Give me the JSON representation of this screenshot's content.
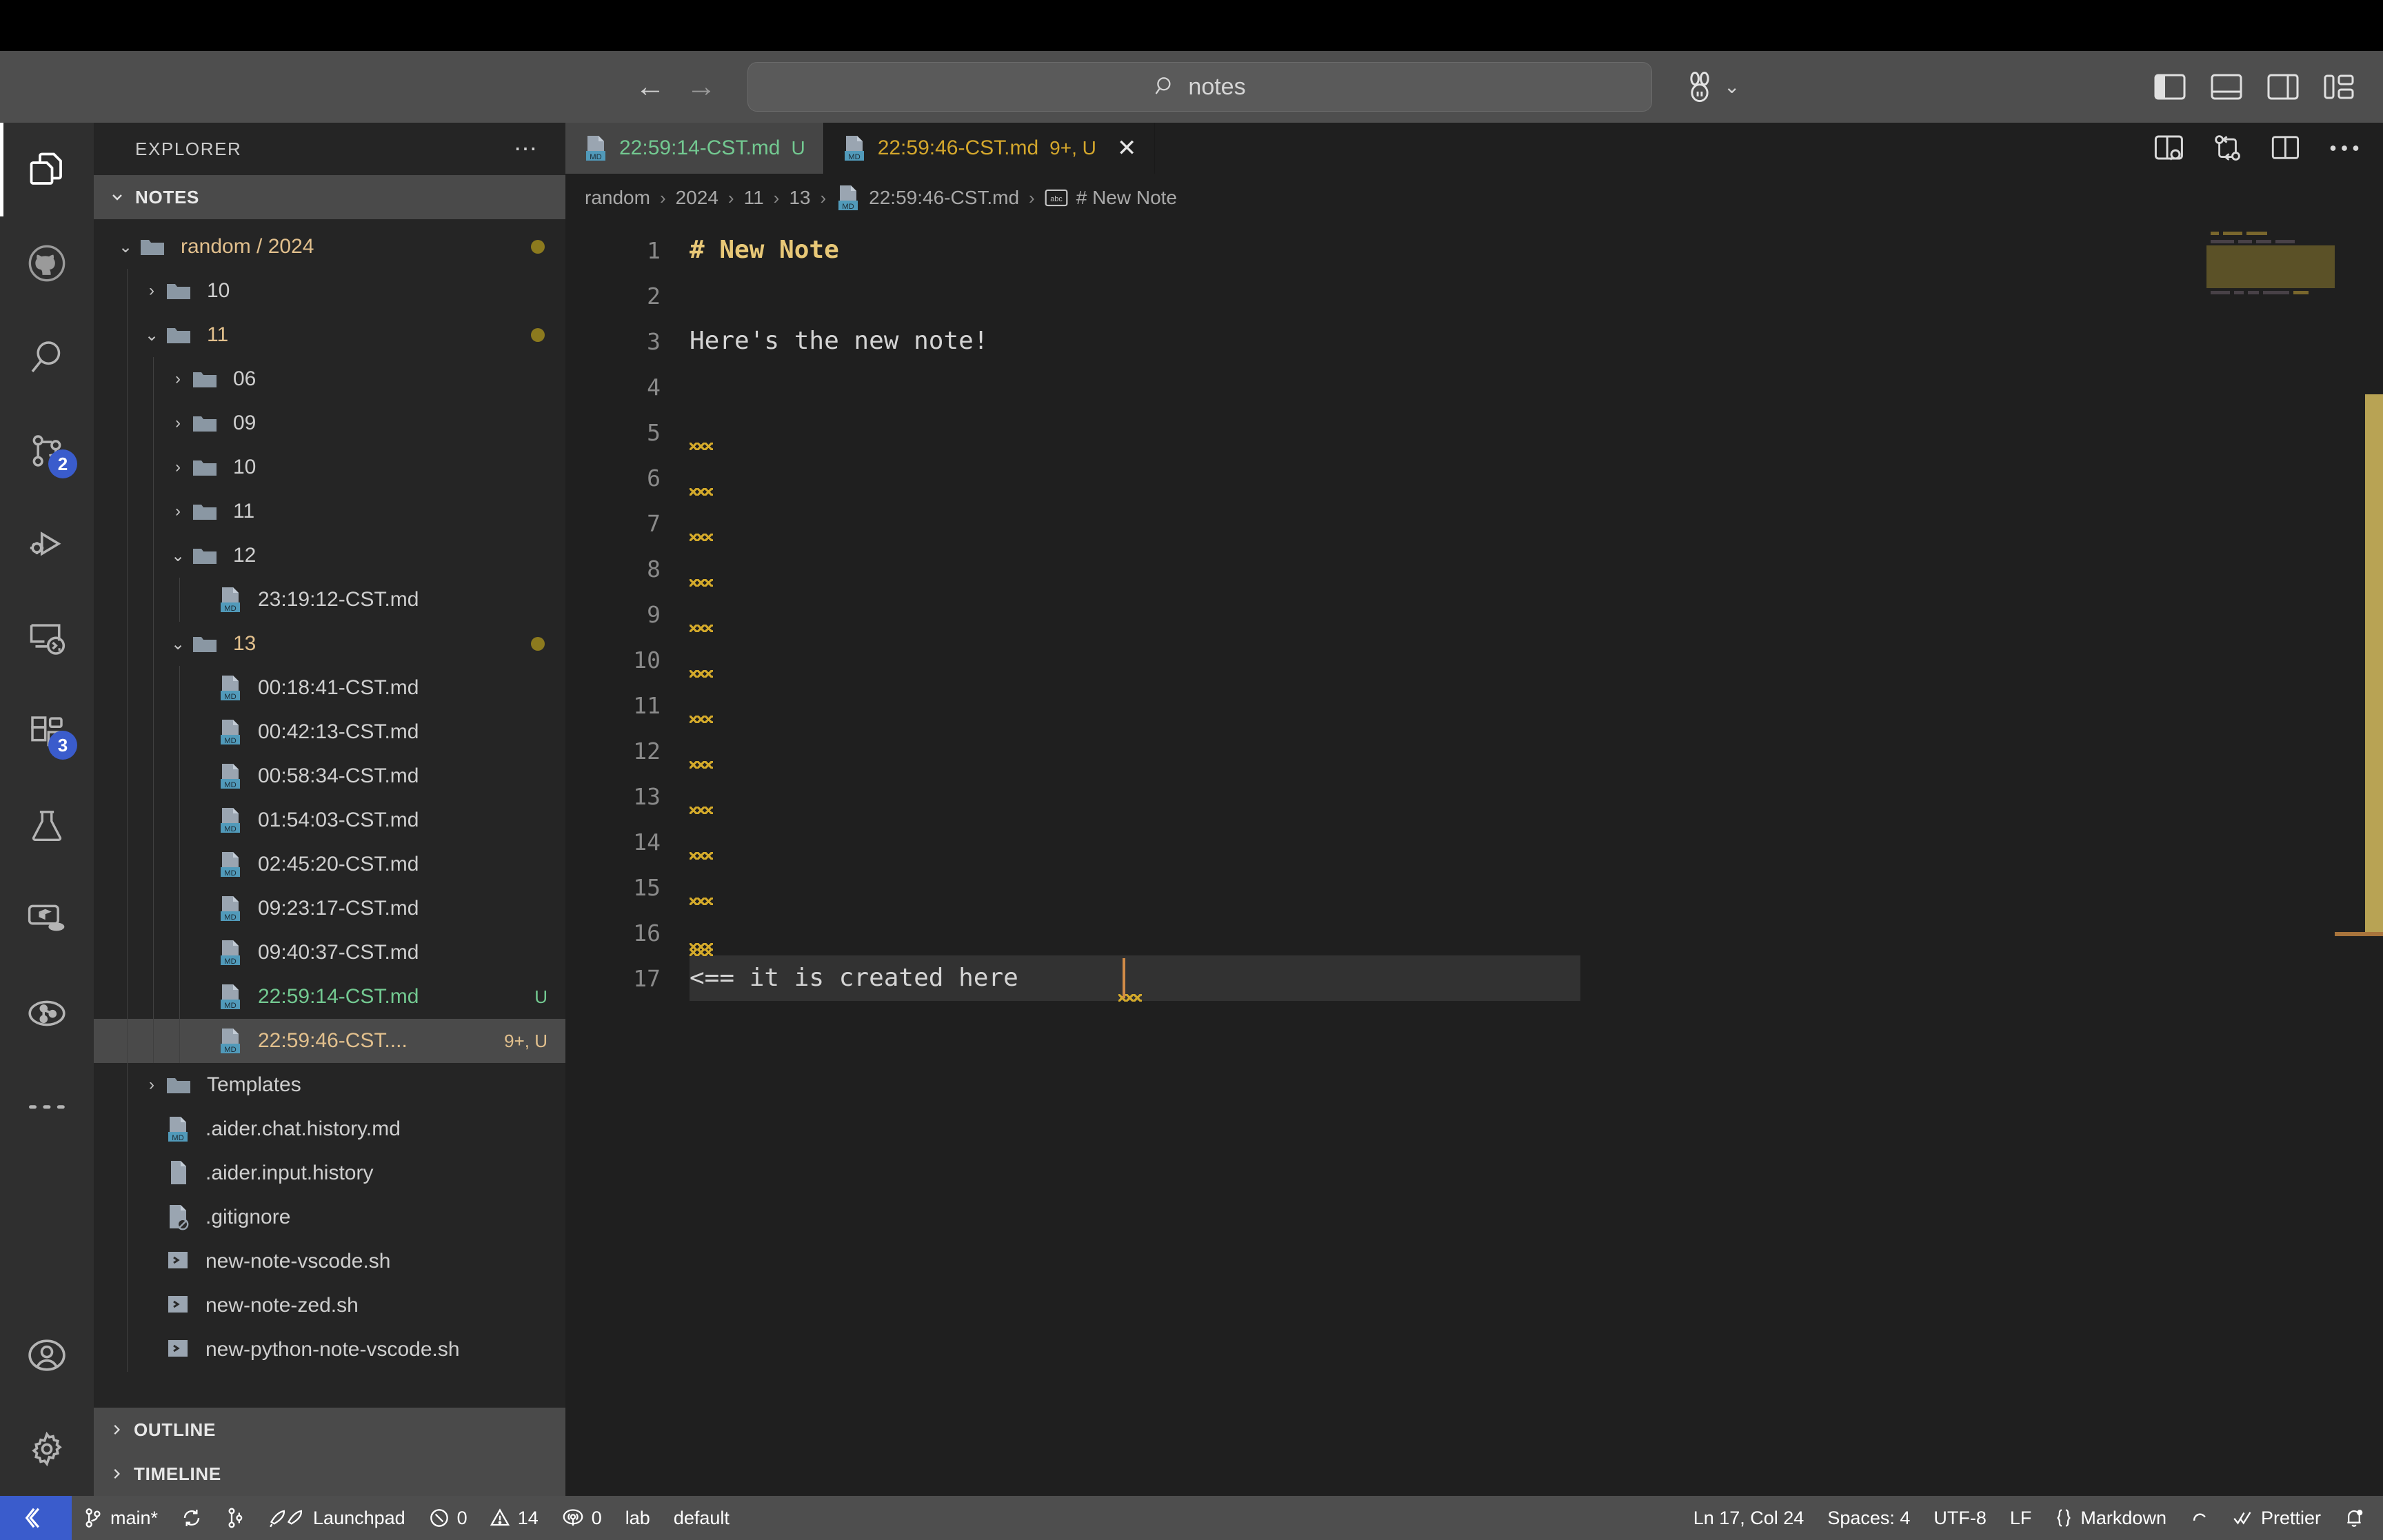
{
  "titlebar": {
    "back_label": "←",
    "forward_label": "→",
    "command_center_text": "notes",
    "rabbit_chevron": "⌄"
  },
  "activity_bar": {
    "items": [
      {
        "name": "explorer",
        "icon": "files-icon",
        "badge": ""
      },
      {
        "name": "github",
        "icon": "github-icon",
        "badge": ""
      },
      {
        "name": "search",
        "icon": "search-icon",
        "badge": ""
      },
      {
        "name": "source-control",
        "icon": "source-control-icon",
        "badge": "2"
      },
      {
        "name": "run-and-debug",
        "icon": "run-debug-icon",
        "badge": ""
      },
      {
        "name": "remote-explorer",
        "icon": "remote-explorer-icon",
        "badge": ""
      },
      {
        "name": "extensions",
        "icon": "extensions-icon",
        "badge": "3"
      },
      {
        "name": "testing",
        "icon": "beaker-icon",
        "badge": ""
      },
      {
        "name": "docker",
        "icon": "docker-icon",
        "badge": ""
      },
      {
        "name": "pipelines",
        "icon": "pipeline-icon",
        "badge": ""
      },
      {
        "name": "more-views",
        "icon": "ellipsis-icon",
        "badge": ""
      },
      {
        "name": "accounts",
        "icon": "account-icon",
        "badge": ""
      },
      {
        "name": "manage",
        "icon": "gear-icon",
        "badge": ""
      }
    ]
  },
  "sidebar": {
    "title": "EXPLORER",
    "more_actions": "⋯",
    "section": "NOTES",
    "tree": [
      {
        "depth": 0,
        "twisty": "⌄",
        "icon": "folder-icon",
        "label": "random / 2024",
        "label_style": "modified",
        "dot": true,
        "badge": ""
      },
      {
        "depth": 1,
        "twisty": "›",
        "icon": "folder-icon",
        "label": "10",
        "label_style": "",
        "dot": false,
        "badge": ""
      },
      {
        "depth": 1,
        "twisty": "⌄",
        "icon": "folder-icon",
        "label": "11",
        "label_style": "modified",
        "dot": true,
        "badge": ""
      },
      {
        "depth": 2,
        "twisty": "›",
        "icon": "folder-icon",
        "label": "06",
        "label_style": "",
        "dot": false,
        "badge": ""
      },
      {
        "depth": 2,
        "twisty": "›",
        "icon": "folder-icon",
        "label": "09",
        "label_style": "",
        "dot": false,
        "badge": ""
      },
      {
        "depth": 2,
        "twisty": "›",
        "icon": "folder-icon",
        "label": "10",
        "label_style": "",
        "dot": false,
        "badge": ""
      },
      {
        "depth": 2,
        "twisty": "›",
        "icon": "folder-icon",
        "label": "11",
        "label_style": "",
        "dot": false,
        "badge": ""
      },
      {
        "depth": 2,
        "twisty": "⌄",
        "icon": "folder-icon",
        "label": "12",
        "label_style": "",
        "dot": false,
        "badge": ""
      },
      {
        "depth": 3,
        "twisty": "",
        "icon": "markdown-file-icon",
        "label": "23:19:12-CST.md",
        "label_style": "",
        "dot": false,
        "badge": ""
      },
      {
        "depth": 2,
        "twisty": "⌄",
        "icon": "folder-icon",
        "label": "13",
        "label_style": "modified",
        "dot": true,
        "badge": ""
      },
      {
        "depth": 3,
        "twisty": "",
        "icon": "markdown-file-icon",
        "label": "00:18:41-CST.md",
        "label_style": "",
        "dot": false,
        "badge": ""
      },
      {
        "depth": 3,
        "twisty": "",
        "icon": "markdown-file-icon",
        "label": "00:42:13-CST.md",
        "label_style": "",
        "dot": false,
        "badge": ""
      },
      {
        "depth": 3,
        "twisty": "",
        "icon": "markdown-file-icon",
        "label": "00:58:34-CST.md",
        "label_style": "",
        "dot": false,
        "badge": ""
      },
      {
        "depth": 3,
        "twisty": "",
        "icon": "markdown-file-icon",
        "label": "01:54:03-CST.md",
        "label_style": "",
        "dot": false,
        "badge": ""
      },
      {
        "depth": 3,
        "twisty": "",
        "icon": "markdown-file-icon",
        "label": "02:45:20-CST.md",
        "label_style": "",
        "dot": false,
        "badge": ""
      },
      {
        "depth": 3,
        "twisty": "",
        "icon": "markdown-file-icon",
        "label": "09:23:17-CST.md",
        "label_style": "",
        "dot": false,
        "badge": ""
      },
      {
        "depth": 3,
        "twisty": "",
        "icon": "markdown-file-icon",
        "label": "09:40:37-CST.md",
        "label_style": "",
        "dot": false,
        "badge": ""
      },
      {
        "depth": 3,
        "twisty": "",
        "icon": "markdown-file-icon",
        "label": "22:59:14-CST.md",
        "label_style": "untracked",
        "dot": false,
        "badge": "U"
      },
      {
        "depth": 3,
        "twisty": "",
        "icon": "markdown-file-icon",
        "label": "22:59:46-CST....",
        "label_style": "modified",
        "dot": false,
        "badge": "9+, U",
        "selected": true
      },
      {
        "depth": 1,
        "twisty": "›",
        "icon": "folder-icon",
        "label": "Templates",
        "label_style": "",
        "dot": false,
        "badge": ""
      },
      {
        "depth": 1,
        "twisty": "",
        "icon": "markdown-file-icon",
        "label": ".aider.chat.history.md",
        "label_style": "",
        "dot": false,
        "badge": ""
      },
      {
        "depth": 1,
        "twisty": "",
        "icon": "plain-file-icon",
        "label": ".aider.input.history",
        "label_style": "",
        "dot": false,
        "badge": ""
      },
      {
        "depth": 1,
        "twisty": "",
        "icon": "gitignore-file-icon",
        "label": ".gitignore",
        "label_style": "",
        "dot": false,
        "badge": ""
      },
      {
        "depth": 1,
        "twisty": "",
        "icon": "shell-file-icon",
        "label": "new-note-vscode.sh",
        "label_style": "",
        "dot": false,
        "badge": ""
      },
      {
        "depth": 1,
        "twisty": "",
        "icon": "shell-file-icon",
        "label": "new-note-zed.sh",
        "label_style": "",
        "dot": false,
        "badge": ""
      },
      {
        "depth": 1,
        "twisty": "",
        "icon": "shell-file-icon",
        "label": "new-python-note-vscode.sh",
        "label_style": "",
        "dot": false,
        "badge": ""
      }
    ],
    "footer_sections": [
      {
        "twisty": "›",
        "label": "OUTLINE"
      },
      {
        "twisty": "›",
        "label": "TIMELINE"
      }
    ]
  },
  "editor": {
    "tabs": [
      {
        "icon": "markdown-file-icon",
        "label": "22:59:14-CST.md",
        "badge": "U",
        "state": "untracked",
        "active": false,
        "closable": false
      },
      {
        "icon": "markdown-file-icon",
        "label": "22:59:46-CST.md",
        "badge": "9+, U",
        "state": "modified",
        "active": true,
        "closable": true,
        "close_glyph": "✕"
      }
    ],
    "tab_actions": [
      {
        "name": "split-editor-search-icon"
      },
      {
        "name": "compare-changes-icon"
      },
      {
        "name": "split-editor-icon"
      },
      {
        "name": "more-actions-icon",
        "glyph": "⋯"
      }
    ],
    "breadcrumb": [
      {
        "text": "random",
        "icon": ""
      },
      {
        "text": "2024",
        "icon": ""
      },
      {
        "text": "11",
        "icon": ""
      },
      {
        "text": "13",
        "icon": ""
      },
      {
        "text": "22:59:46-CST.md",
        "icon": "markdown-file-icon"
      },
      {
        "text": "# New Note",
        "icon": "symbol-string-icon"
      }
    ],
    "breadcrumb_separator": "›",
    "lines": [
      {
        "n": 1,
        "text": "# New Note",
        "style": "h1",
        "squiggle": false
      },
      {
        "n": 2,
        "text": "",
        "style": "normal",
        "squiggle": false
      },
      {
        "n": 3,
        "text": "Here's the new note!",
        "style": "normal",
        "squiggle": false
      },
      {
        "n": 4,
        "text": "",
        "style": "normal",
        "squiggle": false
      },
      {
        "n": 5,
        "text": "",
        "style": "normal",
        "squiggle": true
      },
      {
        "n": 6,
        "text": "",
        "style": "normal",
        "squiggle": true
      },
      {
        "n": 7,
        "text": "",
        "style": "normal",
        "squiggle": true
      },
      {
        "n": 8,
        "text": "",
        "style": "normal",
        "squiggle": true
      },
      {
        "n": 9,
        "text": "",
        "style": "normal",
        "squiggle": true
      },
      {
        "n": 10,
        "text": "",
        "style": "normal",
        "squiggle": true
      },
      {
        "n": 11,
        "text": "",
        "style": "normal",
        "squiggle": true
      },
      {
        "n": 12,
        "text": "",
        "style": "normal",
        "squiggle": true
      },
      {
        "n": 13,
        "text": "",
        "style": "normal",
        "squiggle": true
      },
      {
        "n": 14,
        "text": "",
        "style": "normal",
        "squiggle": true
      },
      {
        "n": 15,
        "text": "",
        "style": "normal",
        "squiggle": true
      },
      {
        "n": 16,
        "text": "",
        "style": "normal",
        "squiggle": true
      },
      {
        "n": 17,
        "text": "<== it is created here ",
        "style": "normal",
        "squiggle": true,
        "current": true
      }
    ]
  },
  "status_bar": {
    "remote_icon": "remote-window-icon",
    "left": [
      {
        "icon": "git-branch-icon",
        "text": "main*"
      },
      {
        "icon": "sync-icon",
        "text": ""
      },
      {
        "icon": "git-changes-icon",
        "text": ""
      },
      {
        "icon": "launchpad-icon",
        "text": "Launchpad"
      },
      {
        "icon": "error-icon",
        "text": "0"
      },
      {
        "icon": "warning-icon",
        "text": "14"
      },
      {
        "icon": "ports-icon",
        "text": "0"
      },
      {
        "icon": "",
        "text": "lab"
      },
      {
        "icon": "",
        "text": "default"
      }
    ],
    "right": [
      {
        "icon": "",
        "text": "Ln 17, Col 24"
      },
      {
        "icon": "",
        "text": "Spaces: 4"
      },
      {
        "icon": "",
        "text": "UTF-8"
      },
      {
        "icon": "",
        "text": "LF"
      },
      {
        "icon": "braces-icon",
        "text": "Markdown"
      },
      {
        "icon": "spinner-icon",
        "text": ""
      },
      {
        "icon": "check-icon",
        "text": "Prettier"
      },
      {
        "icon": "bell-dot-icon",
        "text": ""
      }
    ]
  },
  "colors": {
    "accent_blue": "#3a5ccc",
    "modified_yellow": "#e2c08d",
    "untracked_green": "#73c991",
    "heading_yellow": "#e8c877",
    "warning_squiggle": "#d4aa2b",
    "caret_orange": "#d18b47",
    "titlebar_bg": "#4e4e4e",
    "editor_bg": "#1f1f1f",
    "sidebar_bg": "#252525",
    "activitybar_bg": "#2f2f2f"
  }
}
